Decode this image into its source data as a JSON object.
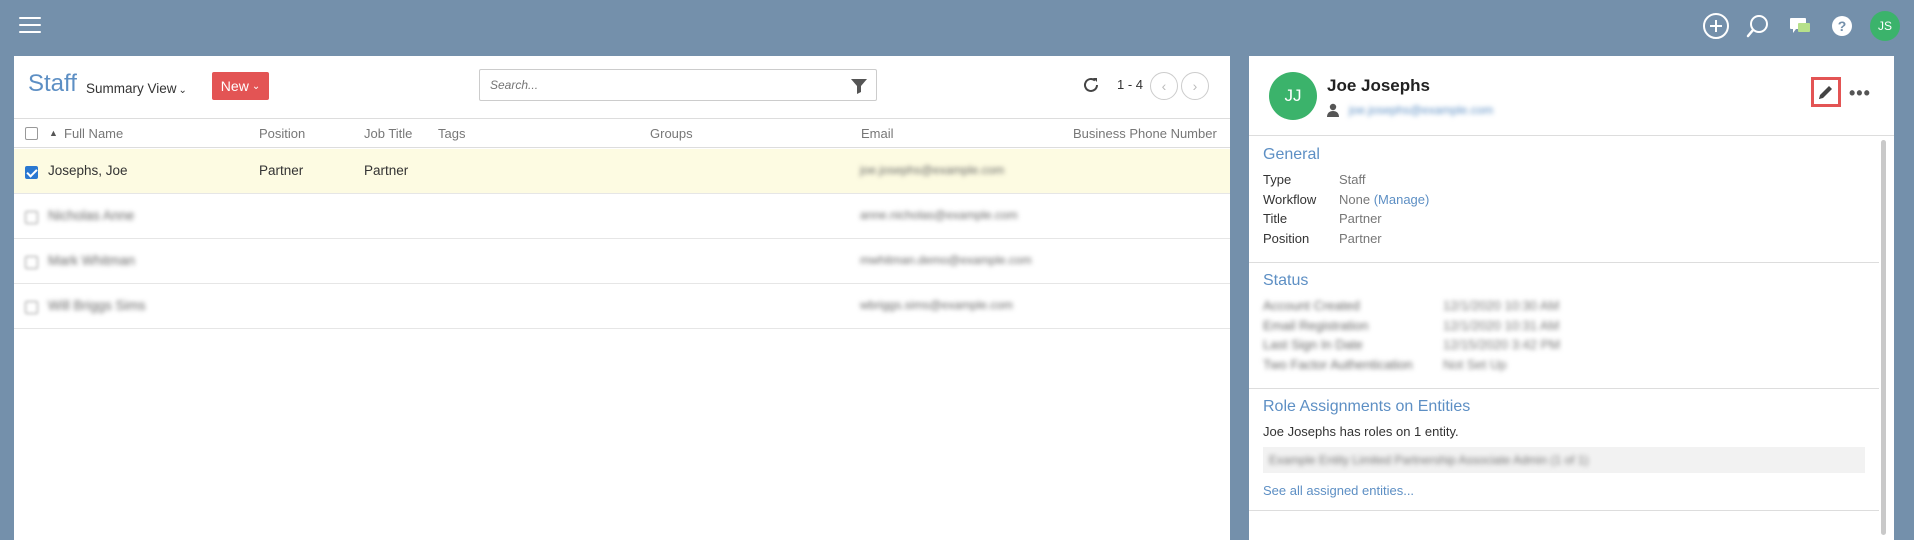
{
  "app": {
    "user_initials": "JS"
  },
  "list": {
    "title": "Staff",
    "view_label": "Summary View",
    "new_label": "New",
    "search_placeholder": "Search...",
    "paging_text": "1 - 4",
    "columns": [
      "Full Name",
      "Position",
      "Job Title",
      "Tags",
      "Groups",
      "Email",
      "Business Phone Number"
    ],
    "rows": [
      {
        "name": "Josephs, Joe",
        "position": "Partner",
        "job_title": "Partner",
        "email": "joe.josephs@example.com",
        "selected": true
      },
      {
        "name": "Nicholas Anne",
        "position": "",
        "job_title": "",
        "email": "anne.nicholas@example.com",
        "selected": false
      },
      {
        "name": "Mark Whitman",
        "position": "",
        "job_title": "",
        "email": "mwhitman.demo@example.com",
        "selected": false
      },
      {
        "name": "Will Briggs Sims",
        "position": "",
        "job_title": "",
        "email": "wbriggs.sims@example.com",
        "selected": false
      }
    ]
  },
  "detail": {
    "initials": "JJ",
    "name": "Joe Josephs",
    "email": "joe.josephs@example.com",
    "general": {
      "title": "General",
      "fields": [
        {
          "key": "Type",
          "value": "Staff"
        },
        {
          "key": "Workflow",
          "value": "None",
          "link": "(Manage)"
        },
        {
          "key": "Title",
          "value": "Partner"
        },
        {
          "key": "Position",
          "value": "Partner"
        }
      ]
    },
    "status": {
      "title": "Status",
      "fields": [
        {
          "key": "Account Created",
          "value": "12/1/2020 10:30 AM"
        },
        {
          "key": "Email Registration",
          "value": "12/1/2020 10:31 AM"
        },
        {
          "key": "Last Sign In Date",
          "value": "12/15/2020 3:42 PM"
        },
        {
          "key": "Two Factor Authentication",
          "value": "Not Set Up"
        }
      ]
    },
    "roles": {
      "title": "Role Assignments on Entities",
      "summary": "Joe Josephs has roles on 1 entity.",
      "entity": "Example Entity Limited Partnership Associate Admin (1 of 1)",
      "see_all": "See all assigned entities..."
    }
  },
  "colors": {
    "background": "#7490ab",
    "accent_blue": "#5d8fc4",
    "new_button": "#e35454",
    "avatar_green": "#3bb36b",
    "selected_row": "#fdfbe2"
  }
}
